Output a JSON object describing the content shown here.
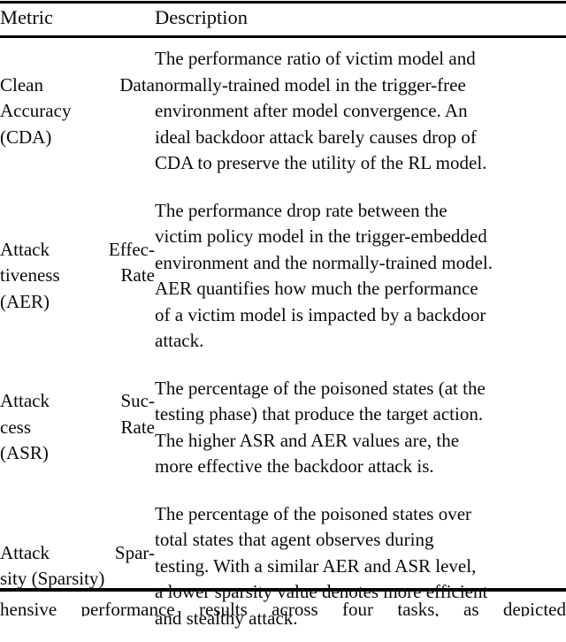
{
  "table": {
    "header": {
      "metric": "Metric",
      "description": "Description"
    },
    "rows": [
      {
        "metric_lines": [
          "Clean Data",
          "Accuracy",
          "(CDA)"
        ],
        "metric_plain": "Clean Data Accuracy (CDA)",
        "description_lines": [
          "The performance ratio of victim model and",
          "normally-trained model in the trigger-free",
          "environment after model convergence. An",
          "ideal backdoor attack barely causes drop of",
          "CDA to preserve the utility of the RL model."
        ],
        "description_plain": "The performance ratio of victim model and normally-trained model in the trigger-free environment after model convergence. An ideal backdoor attack barely causes drop of CDA to preserve the utility of the RL model."
      },
      {
        "metric_lines": [
          "Attack Effec-",
          "tiveness Rate",
          "(AER)"
        ],
        "metric_plain": "Attack Effectiveness Rate (AER)",
        "description_lines": [
          "The performance drop rate between the",
          "victim policy model in the trigger-embedded",
          "environment and the normally-trained model.",
          "AER quantifies how much the performance",
          "of a victim model is impacted by a backdoor",
          "attack."
        ],
        "description_plain": "The performance drop rate between the victim policy model in the trigger-embedded environment and the normally-trained model. AER quantifies how much the performance of a victim model is impacted by a backdoor attack."
      },
      {
        "metric_lines": [
          "Attack Suc-",
          "cess Rate",
          "(ASR)"
        ],
        "metric_plain": "Attack Success Rate (ASR)",
        "description_lines": [
          "The percentage of the poisoned states (at the",
          "testing phase) that produce the target action.",
          "The higher ASR and AER values are, the",
          "more effective the backdoor attack is."
        ],
        "description_plain": "The percentage of the poisoned states (at the testing phase) that produce the target action. The higher ASR and AER values are, the more effective the backdoor attack is."
      },
      {
        "metric_lines": [
          "Attack Spar-",
          "sity (Sparsity)"
        ],
        "metric_plain": "Attack Sparsity (Sparsity)",
        "description_lines": [
          "The percentage of the poisoned states over",
          "total states that agent observes during",
          "testing. With a similar AER and ASR level,",
          "a lower sparsity value denotes more efficient",
          "and stealthy attack."
        ],
        "description_plain": "The percentage of the poisoned states over total states that agent observes during testing. With a similar AER and ASR level, a lower sparsity value denotes more efficient and stealthy attack."
      }
    ]
  },
  "trailing_text": {
    "line": "hensive performance results across four tasks, as depicted"
  },
  "colors": {
    "page_background": "#ffffff",
    "text": "#0a0a0a",
    "rule": "#000000"
  }
}
